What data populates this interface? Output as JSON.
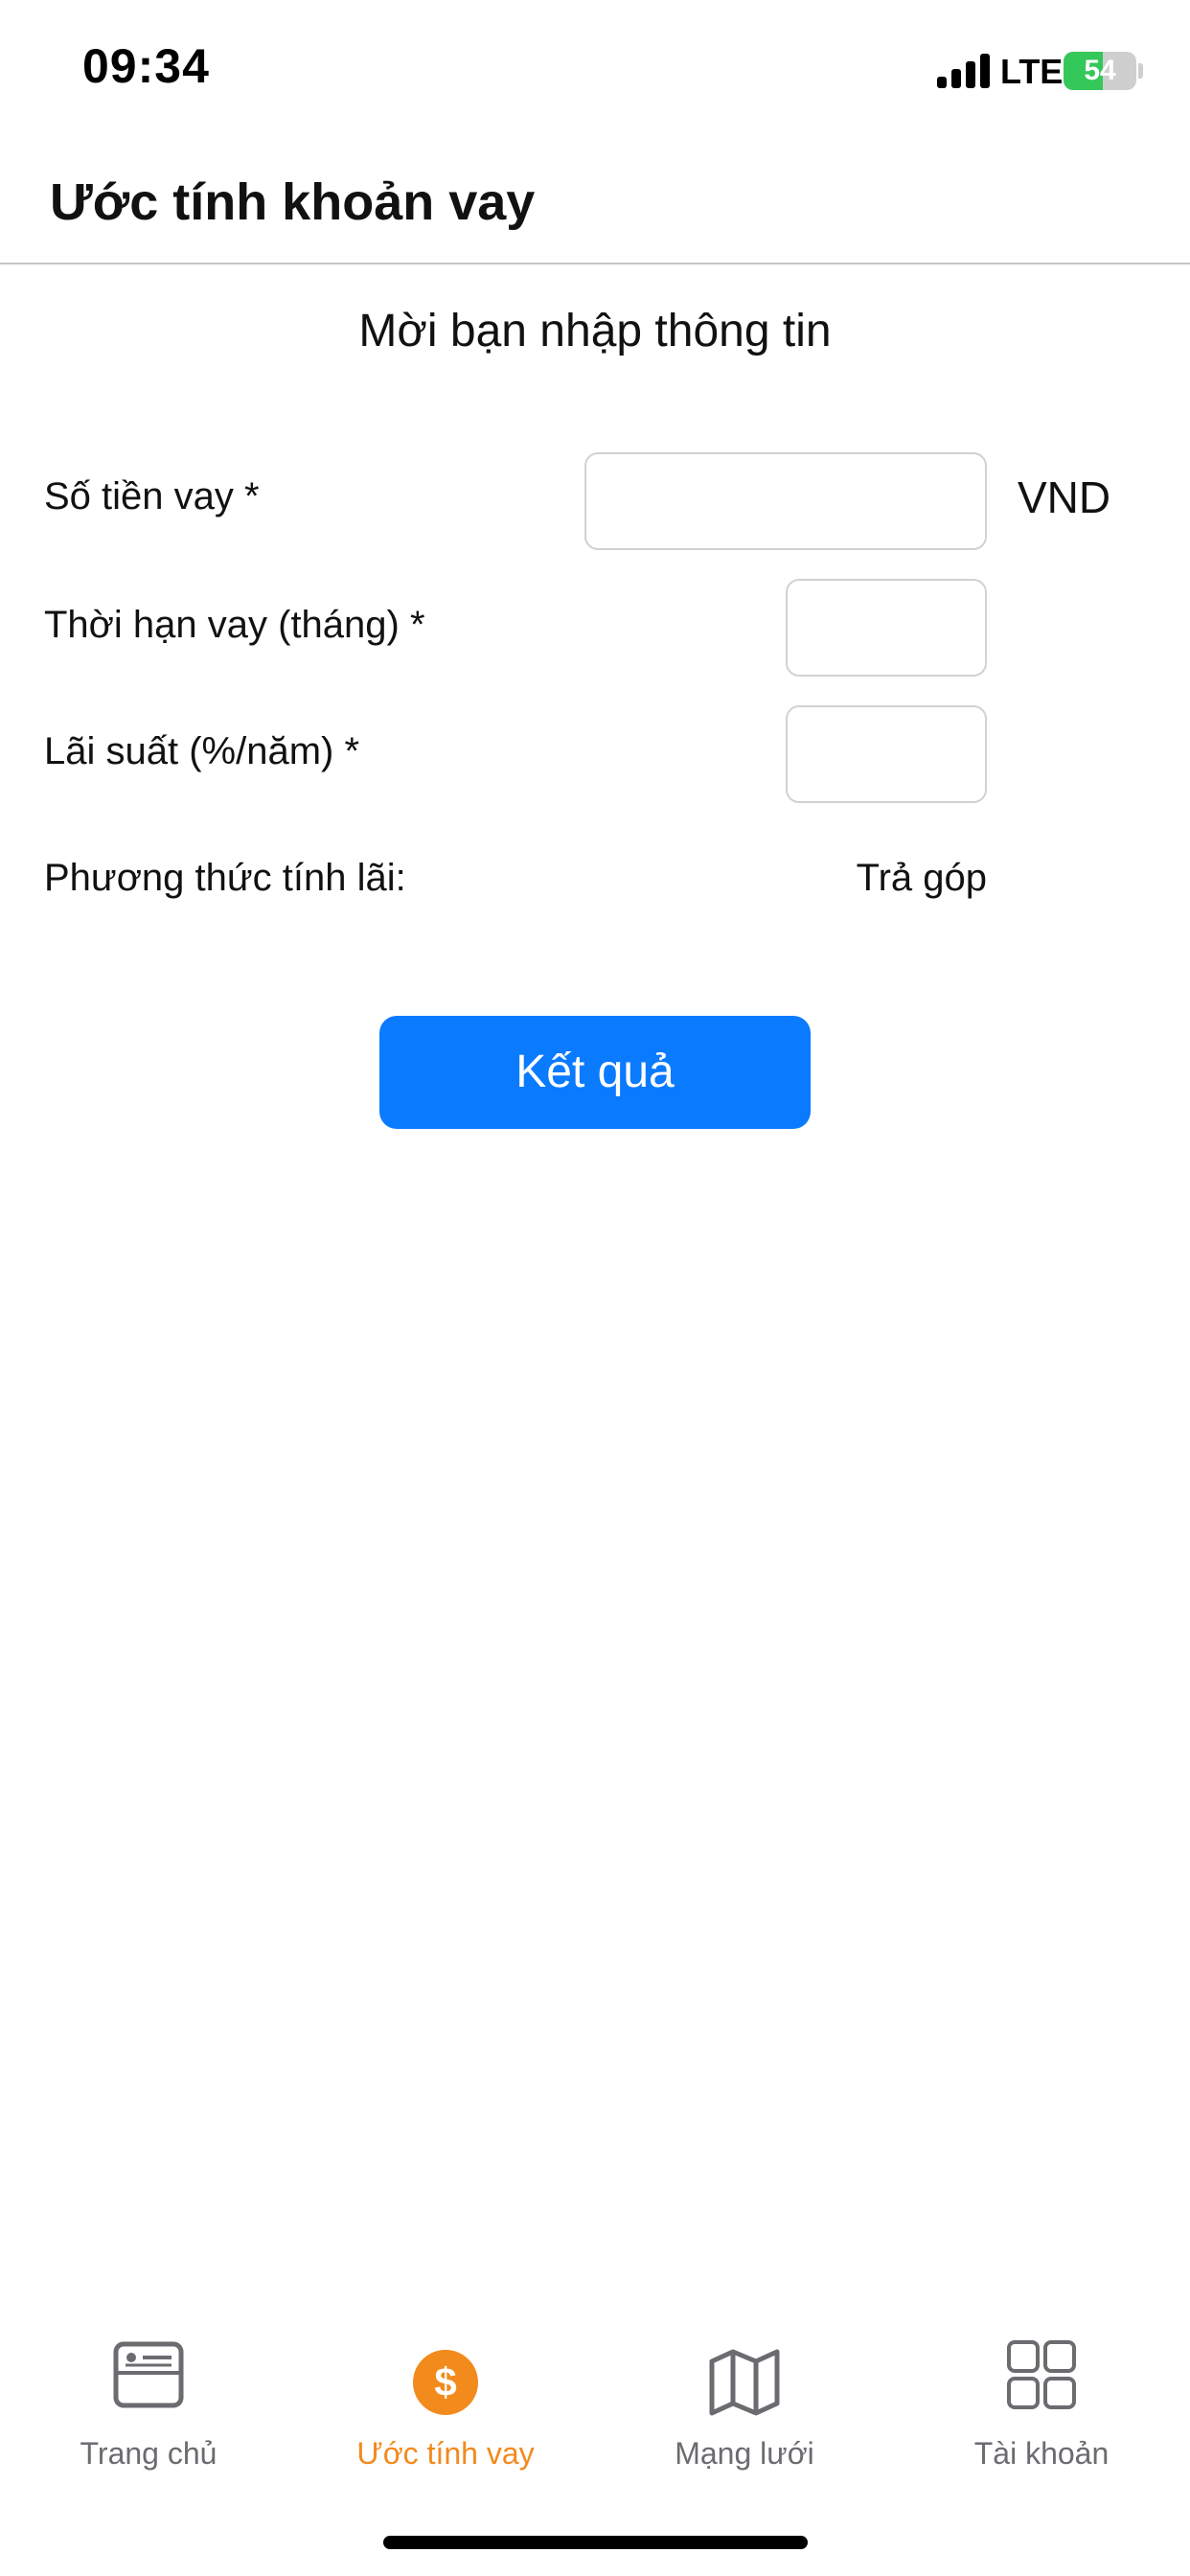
{
  "status_bar": {
    "time": "09:34",
    "network": "LTE",
    "battery": "54",
    "battery_level": 0.54
  },
  "header": {
    "title": "Ước tính khoản vay"
  },
  "form": {
    "heading": "Mời bạn nhập thông tin",
    "loan_amount_label": "Số tiền vay *",
    "loan_amount_value": "",
    "currency_unit": "VND",
    "term_label": "Thời hạn vay (tháng) *",
    "term_value": "",
    "rate_label": "Lãi suất (%/năm) *",
    "rate_value": "",
    "method_label": "Phương thức tính lãi:",
    "method_value": "Trả góp",
    "submit_label": "Kết quả"
  },
  "tabs": [
    {
      "label": "Trang chủ",
      "icon": "home-icon",
      "active": false
    },
    {
      "label": "Ước tính vay",
      "icon": "dollar-icon",
      "active": true
    },
    {
      "label": "Mạng lưới",
      "icon": "map-icon",
      "active": false
    },
    {
      "label": "Tài khoản",
      "icon": "grid-icon",
      "active": false
    }
  ],
  "colors": {
    "accent": "#0a7aff",
    "active_tab": "#f28a1c",
    "inactive_tab": "#6b6b70",
    "battery": "#34c759"
  }
}
